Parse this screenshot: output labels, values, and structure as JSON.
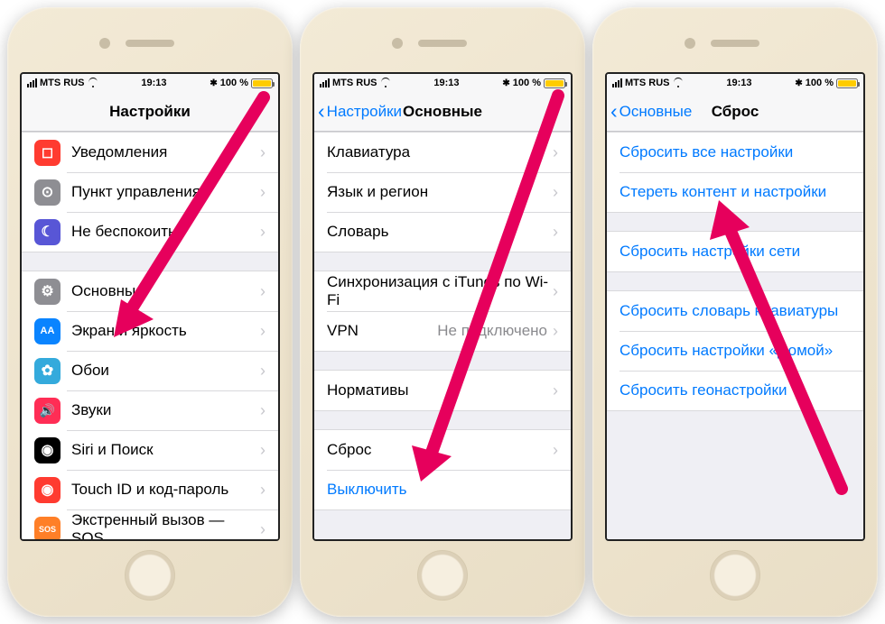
{
  "status": {
    "carrier": "MTS RUS",
    "time": "19:13",
    "battery_pct": "100 %",
    "bluetooth_glyph": "✱"
  },
  "phone1": {
    "title": "Настройки",
    "items": [
      {
        "icon": "notifications",
        "color": "#ff3b30",
        "glyph": "◻",
        "label": "Уведомления"
      },
      {
        "icon": "control-center",
        "color": "#8e8e93",
        "glyph": "⊙",
        "label": "Пункт управления"
      },
      {
        "icon": "dnd",
        "color": "#5856d6",
        "glyph": "☾",
        "label": "Не беспокоить"
      }
    ],
    "items2": [
      {
        "icon": "general",
        "color": "#8e8e93",
        "glyph": "⚙",
        "label": "Основные"
      },
      {
        "icon": "display",
        "color": "#0a84ff",
        "glyph": "AA",
        "label": "Экран и яркость",
        "fs": "11"
      },
      {
        "icon": "wallpaper",
        "color": "#34aadc",
        "glyph": "✿",
        "label": "Обои"
      },
      {
        "icon": "sounds",
        "color": "#ff2d55",
        "glyph": "🔊",
        "label": "Звуки",
        "fs": "14"
      },
      {
        "icon": "siri",
        "color": "#000",
        "glyph": "◉",
        "label": "Siri и Поиск"
      },
      {
        "icon": "touchid",
        "color": "#ff3b30",
        "glyph": "◉",
        "label": "Touch ID и код-пароль"
      },
      {
        "icon": "sos",
        "color": "#ff7f27",
        "glyph": "SOS",
        "label": "Экстренный вызов — SOS",
        "fs": "9"
      }
    ]
  },
  "phone2": {
    "back": "Настройки",
    "title": "Основные",
    "groups": [
      {
        "cells": [
          {
            "label": "Клавиатура",
            "disclosure": true
          },
          {
            "label": "Язык и регион",
            "disclosure": true
          },
          {
            "label": "Словарь",
            "disclosure": true
          }
        ]
      },
      {
        "cells": [
          {
            "label": "Синхронизация с iTunes по Wi-Fi",
            "disclosure": true
          },
          {
            "label": "VPN",
            "detail": "Не подключено",
            "disclosure": true
          }
        ]
      },
      {
        "cells": [
          {
            "label": "Нормативы",
            "disclosure": true
          }
        ]
      },
      {
        "cells": [
          {
            "label": "Сброс",
            "disclosure": true
          },
          {
            "label": "Выключить",
            "blue": true,
            "disclosure": false
          }
        ]
      }
    ]
  },
  "phone3": {
    "back": "Основные",
    "title": "Сброс",
    "groups": [
      {
        "cells": [
          {
            "label": "Сбросить все настройки",
            "blue": true
          },
          {
            "label": "Стереть контент и настройки",
            "blue": true
          }
        ]
      },
      {
        "cells": [
          {
            "label": "Сбросить настройки сети",
            "blue": true
          }
        ]
      },
      {
        "cells": [
          {
            "label": "Сбросить словарь клавиатуры",
            "blue": true
          },
          {
            "label": "Сбросить настройки «Домой»",
            "blue": true
          },
          {
            "label": "Сбросить геонастройки",
            "blue": true
          }
        ]
      }
    ]
  },
  "arrow_color": "#e6005c"
}
